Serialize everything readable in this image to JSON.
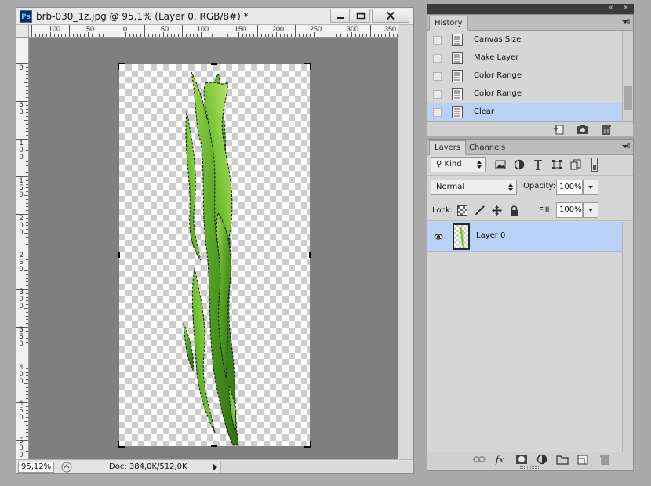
{
  "document": {
    "app_icon": "Ps",
    "title": "brb-030_1z.jpg @ 95,1% (Layer 0, RGB/8#) *",
    "ruler_h_labels": [
      "100",
      "50",
      "0",
      "50",
      "100",
      "150",
      "200",
      "250",
      "300",
      "350"
    ],
    "ruler_v_labels": [
      "0",
      "50",
      "100",
      "150",
      "200",
      "250",
      "300",
      "350",
      "400",
      "450",
      "500"
    ],
    "zoom": "95,12%",
    "doc_info": "Doc: 384,0K/512,0K"
  },
  "history": {
    "tab": "History",
    "items": [
      {
        "label": "Canvas Size"
      },
      {
        "label": "Make Layer"
      },
      {
        "label": "Color Range"
      },
      {
        "label": "Color Range"
      },
      {
        "label": "Clear"
      }
    ],
    "selected_index": 4
  },
  "layers": {
    "tabs": [
      "Layers",
      "Channels"
    ],
    "active_tab": "Layers",
    "filter_kind": "Kind",
    "blend_mode": "Normal",
    "opacity_label": "Opacity:",
    "opacity": "100%",
    "lock_label": "Lock:",
    "fill_label": "Fill:",
    "fill": "100%",
    "layer_items": [
      {
        "name": "Layer 0",
        "visible": true,
        "selected": true
      }
    ]
  },
  "colors": {
    "selection_blue": "#b9d1f5",
    "pasteboard": "#7f7f7f",
    "plant_green": "#6fbf2a"
  }
}
